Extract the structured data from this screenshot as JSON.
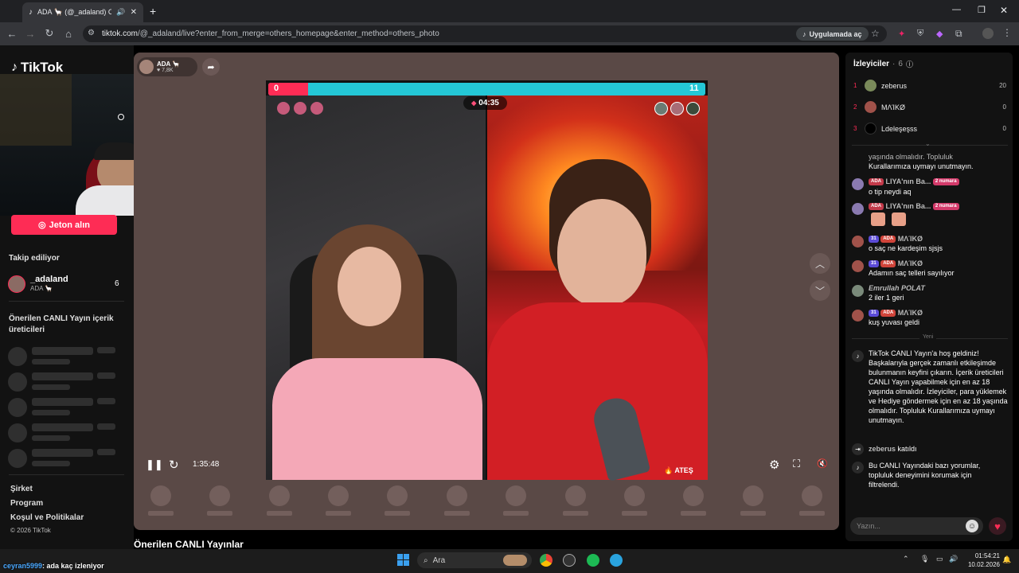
{
  "browser": {
    "tab_title": "ADA 🦙 (@_adaland) CANL",
    "url_host": "tiktok.com",
    "url_path": "/@_adaland/live?enter_from_merge=others_homepage&enter_method=others_photo",
    "open_in_app": "Uygulamada aç"
  },
  "sidebar": {
    "logo": "TikTok",
    "jeton_button": "Jeton alın",
    "following_heading": "Takip ediliyor",
    "following": [
      {
        "name": "_adaland",
        "sub": "ADA 🦙",
        "count": "6"
      }
    ],
    "suggested_heading": "Önerilen CANLI Yayın içerik üreticileri",
    "footer_links": [
      "Şirket",
      "Program",
      "Koşul ve Politikalar"
    ],
    "copyright": "© 2026 TikTok"
  },
  "stream": {
    "host_name": "ADA 🦙",
    "host_likes": "7,8K",
    "battle_left_score": "0",
    "battle_right_score": "11",
    "battle_timer": "04:35",
    "right_tag": "ATEŞ",
    "elapsed": "1:35:48",
    "below_title": "Önerilen CANLI Yayınlar"
  },
  "viewers": {
    "heading": "İzleyiciler",
    "count": "6",
    "list": [
      {
        "rank": "1",
        "name": "zeberus",
        "score": "20",
        "color": "#7a8a5a"
      },
      {
        "rank": "2",
        "name": "MΛΊKØ",
        "score": "0",
        "color": "#a0524a"
      },
      {
        "rank": "3",
        "name": "Ldeleşeşss",
        "score": "0",
        "color": "#000000"
      }
    ]
  },
  "chat": {
    "partial_top": "yaşında olmalıdır. Topluluk",
    "partial_top2": "Kurallarımıza uymayı unutmayın.",
    "messages": [
      {
        "badges": [
          "ADA"
        ],
        "nick": "LIYA'nın Ba...",
        "rank": "2 numara",
        "text": "o tip neydi aq"
      },
      {
        "badges": [
          "ADA"
        ],
        "nick": "LIYA'nın Ba...",
        "rank": "2 numara",
        "text": ""
      },
      {
        "badges": [
          "31",
          "ADA"
        ],
        "nick": "MΛΊKØ",
        "rank": "",
        "text": "o saç ne kardeşim sjsjs"
      },
      {
        "badges": [
          "31",
          "ADA"
        ],
        "nick": "MΛΊKØ",
        "rank": "",
        "text": "Adamın saç telleri sayılıyor"
      },
      {
        "badges": [],
        "nick": "Emrullah POLAT",
        "rank": "",
        "text": "2 iler 1 geri"
      },
      {
        "badges": [
          "31",
          "ADA"
        ],
        "nick": "MΛΊKØ",
        "rank": "",
        "text": "kuş yuvası geldi"
      }
    ],
    "divider": "Yeni",
    "welcome": "TikTok CANLI Yayın'a hoş geldiniz! Başkalarıyla gerçek zamanlı etkileşimde bulunmanın keyfini çıkarın. İçerik üreticileri CANLI Yayın yapabilmek için en az 18 yaşında olmalıdır. İzleyiciler, para yüklemek ve Hediye göndermek için en az 18 yaşında olmalıdır. Topluluk Kurallarımıza uymayı unutmayın.",
    "join_nick": "zeberus",
    "join_text": "katıldı",
    "filter_notice": "Bu CANLI Yayındaki bazı yorumlar, topluluk deneyimini korumak için filtrelendi.",
    "input_placeholder": "Yazın..."
  },
  "taskbar": {
    "search_label": "Ara",
    "time": "01:54:21",
    "date": "10.02.2026"
  },
  "overlay_chat": {
    "user": "ceyran5999",
    "text": ": ada kaç izleniyor"
  }
}
